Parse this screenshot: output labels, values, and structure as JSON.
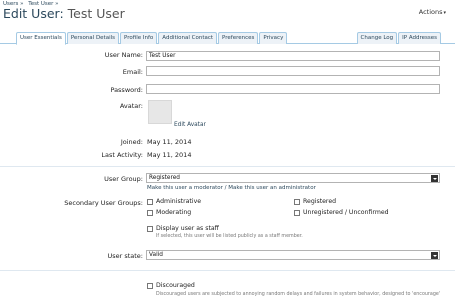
{
  "breadcrumb": [
    "Users »",
    "Test User »"
  ],
  "title": {
    "prefix": "Edit User:",
    "name": "Test User"
  },
  "actions_label": "Actions",
  "tabs_left": [
    "User Essentials",
    "Personal Details",
    "Profile Info",
    "Additional Contact",
    "Preferences",
    "Privacy"
  ],
  "tabs_right": [
    "Change Log",
    "IP Addresses"
  ],
  "form": {
    "username_label": "User Name:",
    "username_value": "Test User",
    "email_label": "Email:",
    "email_value": "",
    "password_label": "Password:",
    "password_value": "",
    "avatar_label": "Avatar:",
    "edit_avatar": "Edit Avatar",
    "joined_label": "Joined:",
    "joined_value": "May 11, 2014",
    "last_activity_label": "Last Activity:",
    "last_activity_value": "May 11, 2014",
    "user_group_label": "User Group:",
    "user_group_value": "Registered",
    "make_moderator": "Make this user a moderator",
    "separator": "/",
    "make_admin": "Make this user an administrator",
    "secondary_label": "Secondary User Groups:",
    "groups": [
      "Administrative",
      "Registered",
      "Moderating",
      "Unregistered / Unconfirmed"
    ],
    "staff_label": "Display user as staff",
    "staff_hint": "If selected, this user will be listed publicly as a staff member.",
    "user_state_label": "User state:",
    "user_state_value": "Valid",
    "discouraged_label": "Discouraged",
    "discouraged_hint": "Discouraged users are subjected to annoying random delays and failures in system behavior, designed to 'encourage'"
  }
}
